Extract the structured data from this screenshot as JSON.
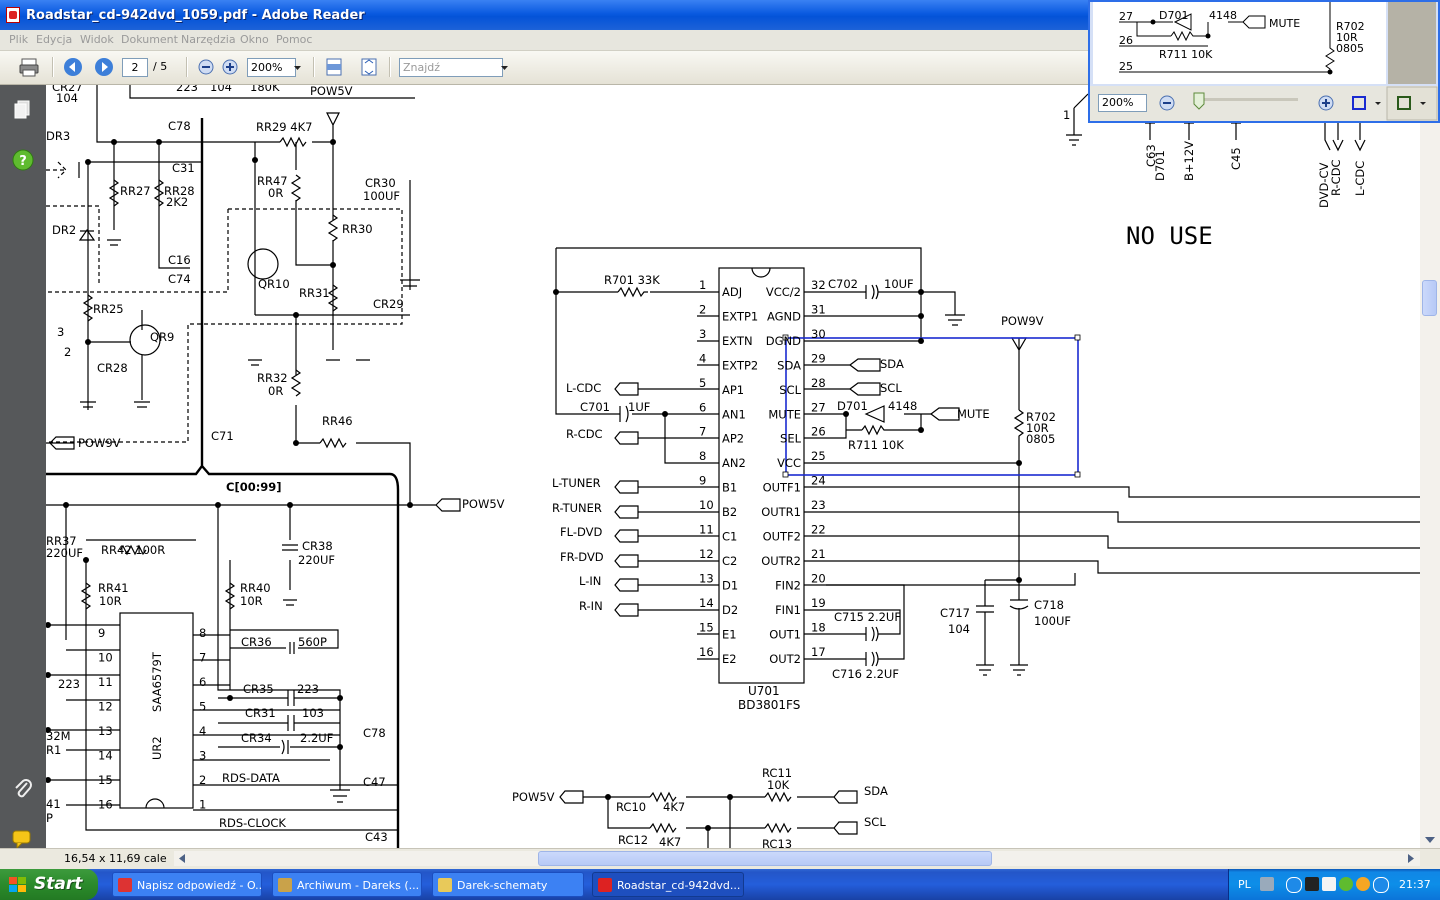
{
  "window": {
    "title": "Roadstar_cd-942dvd_1059.pdf - Adobe Reader"
  },
  "menu": [
    "Plik",
    "Edycja",
    "Widok",
    "Dokument",
    "Narzędzia",
    "Okno",
    "Pomoc"
  ],
  "toolbar": {
    "page_current": "2",
    "page_total": "/ 5",
    "zoom": "200%",
    "find_placeholder": "Znajdź"
  },
  "statusbar": {
    "page_size": "16,54 x 11,69 cale"
  },
  "pan_zoom": {
    "zoom": "200%"
  },
  "schematic": {
    "no_use": "NO USE",
    "ic_main": {
      "ref": "U701",
      "part": "BD3801FS"
    },
    "ic_left": {
      "ref": "UR2",
      "part": "SAA6579T"
    },
    "bus_label": "C[00:99]",
    "pins_left": [
      {
        "n": "1",
        "name": "ADJ"
      },
      {
        "n": "2",
        "name": "EXTP1"
      },
      {
        "n": "3",
        "name": "EXTN"
      },
      {
        "n": "4",
        "name": "EXTP2"
      },
      {
        "n": "5",
        "name": "AP1"
      },
      {
        "n": "6",
        "name": "AN1"
      },
      {
        "n": "7",
        "name": "AP2"
      },
      {
        "n": "8",
        "name": "AN2"
      },
      {
        "n": "9",
        "name": "B1"
      },
      {
        "n": "10",
        "name": "B2"
      },
      {
        "n": "11",
        "name": "C1"
      },
      {
        "n": "12",
        "name": "C2"
      },
      {
        "n": "13",
        "name": "D1"
      },
      {
        "n": "14",
        "name": "D2"
      },
      {
        "n": "15",
        "name": "E1"
      },
      {
        "n": "16",
        "name": "E2"
      }
    ],
    "pins_right": [
      {
        "n": "32",
        "name": "VCC/2"
      },
      {
        "n": "31",
        "name": "AGND"
      },
      {
        "n": "30",
        "name": "DGND"
      },
      {
        "n": "29",
        "name": "SDA"
      },
      {
        "n": "28",
        "name": "SCL"
      },
      {
        "n": "27",
        "name": "MUTE"
      },
      {
        "n": "26",
        "name": "SEL"
      },
      {
        "n": "25",
        "name": "VCC"
      },
      {
        "n": "24",
        "name": "OUTF1"
      },
      {
        "n": "23",
        "name": "OUTR1"
      },
      {
        "n": "22",
        "name": "OUTF2"
      },
      {
        "n": "21",
        "name": "OUTR2"
      },
      {
        "n": "20",
        "name": "FIN2"
      },
      {
        "n": "19",
        "name": "FIN1"
      },
      {
        "n": "18",
        "name": "OUT1"
      },
      {
        "n": "17",
        "name": "OUT2"
      }
    ],
    "inputs": [
      "L-CDC",
      "R-CDC",
      "L-TUNER",
      "R-TUNER",
      "FL-DVD",
      "FR-DVD",
      "L-IN",
      "R-IN"
    ],
    "ur2_left_pins": [
      "9",
      "10",
      "11",
      "12",
      "13",
      "14",
      "15",
      "16"
    ],
    "ur2_right_pins": [
      "8",
      "7",
      "6",
      "5",
      "4",
      "3",
      "2",
      "1"
    ],
    "labels": {
      "r701": "R701 33K",
      "c702": "C702",
      "c702v": "10UF",
      "c701": "C701",
      "c701v": "1UF",
      "pow9v": "POW9V",
      "pow5v": "POW5V",
      "d701": "D701",
      "d4148": "4148",
      "r711": "R711  10K",
      "r702": "R702",
      "r702a": "10R",
      "r702b": "0805",
      "mute": "MUTE",
      "sda": "SDA",
      "scl": "SCL",
      "c715": "C715 2.2UF",
      "c716": "C716  2.2UF",
      "c717": "C717",
      "c717v": "104",
      "c718": "C718",
      "c718v": "100UF",
      "rc10": "RC10",
      "rc10v": "4K7",
      "rc11": "RC11",
      "rc11v": "10K",
      "rc12": "RC12",
      "rc12v": "4K7",
      "rc13": "RC13",
      "rr29": "RR29  4K7",
      "rr27": "RR27",
      "rr28": "RR28",
      "rr28v": "2K2",
      "rr47": "RR47",
      "rr47v": "0R",
      "cr30": "CR30",
      "cr30v": "100UF",
      "rr30": "RR30",
      "qr10": "QR10",
      "rr31": "RR31",
      "cr29": "CR29",
      "c78": "C78",
      "c31": "C31",
      "c16": "C16",
      "c74": "C74",
      "dr2": "DR2",
      "dr3": "DR3",
      "rr25": "RR25",
      "qr9": "QR9",
      "cr28": "CR28",
      "rr32": "RR32",
      "rr32v": "0R",
      "rr46": "RR46",
      "c71": "C71",
      "cr27": "CR27",
      "cr27v": "104",
      "top223": "223",
      "top104": "104",
      "top180k": "180K",
      "rr37": "RR37",
      "rr37v": "220UF",
      "rr42": "RR42   100R",
      "cr38": "CR38",
      "cr38v": "220UF",
      "rr41": "RR41",
      "rr41v": "10R",
      "rr40": "RR40",
      "rr40v": "10R",
      "cr36": "CR36",
      "cr36v": "560P",
      "cr35": "CR35",
      "cr35v": "223",
      "cr31": "CR31",
      "cr31v": "103",
      "cr34": "CR34",
      "cr34v": "2.2UF",
      "rdsdata": "RDS-DATA",
      "rdsclock": "RDS-CLOCK",
      "c47": "C47",
      "c43": "C43",
      "c78b": "C78",
      "l223": "223",
      "l32m": "32M",
      "lr1": "R1",
      "l41": "41",
      "lp": "P",
      "two": "2",
      "three": "3",
      "one": "1",
      "c63": "C63",
      "d701b": "D701",
      "b12v": "B+12V",
      "c45": "C45",
      "dvdcv": "DVD-CV",
      "rcdc": "R-CDC",
      "lcdc": "L-CDC"
    }
  },
  "taskbar": {
    "start": "Start",
    "tasks": [
      {
        "label": "Napisz odpowiedź - O...",
        "color": "#d33"
      },
      {
        "label": "Archiwum - Dareks (...",
        "color": "#c9a24a"
      },
      {
        "label": "Darek-schematy",
        "color": "#e8c95a"
      },
      {
        "label": "Roadstar_cd-942dvd...",
        "color": "#d22"
      }
    ],
    "lang": "PL",
    "clock": "21:37"
  }
}
